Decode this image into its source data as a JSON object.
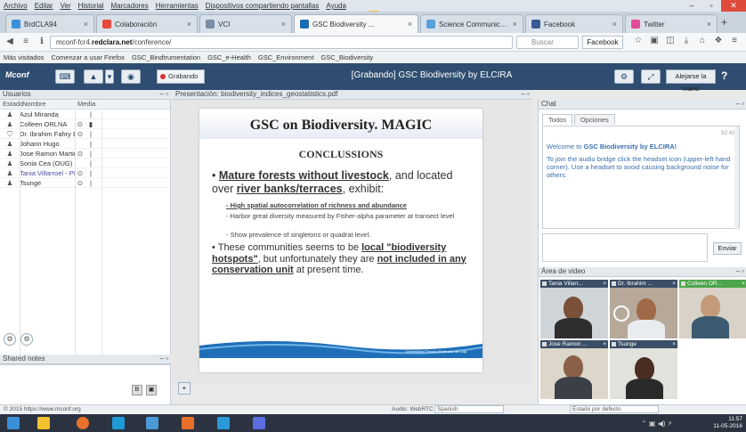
{
  "menu": [
    "Archivo",
    "Editar",
    "Ver",
    "Historial",
    "Marcadores",
    "Herramientas",
    "Dispositivos compartiendo pantallas",
    "Ayuda"
  ],
  "tabs": [
    {
      "label": "BrdCLA94",
      "color": "#3a8fd6"
    },
    {
      "label": "Colaboración",
      "color": "#e64a3a"
    },
    {
      "label": "VCI",
      "color": "#7a8ea3"
    },
    {
      "label": "GSC Biodiversity ...",
      "color": "#1b6bb3"
    },
    {
      "label": "Science Communication",
      "color": "#5aa0d8"
    },
    {
      "label": "Facebook",
      "color": "#3b5998"
    },
    {
      "label": "Twitter",
      "color": "#e64a9a"
    }
  ],
  "nav": {
    "url_prefix": "mconf-fcr4.",
    "url_domain": "redclara.net",
    "url_suffix": "/conference/",
    "search_placeholder": "Buscar",
    "facebook_box": "Facebook"
  },
  "bookmarks": [
    "Más visitados",
    "Comenzar a usar Firefox",
    "GSC_Bindtrumentation",
    "GSC_e-Health",
    "GSC_Environment",
    "GSC_Biodiversity"
  ],
  "app": {
    "logo": "Mconf",
    "record_label": "Grabando",
    "title": "[Grabando] GSC Biodiversity by ELCIRA",
    "hand_label": "Alejarse la mano"
  },
  "users": {
    "panel_title": "Usuarios",
    "columns": [
      "Estado",
      "Nombre",
      "Media"
    ],
    "rows": [
      {
        "status": "♟",
        "name": "Azul Miranda",
        "mic": "",
        "cam": "|"
      },
      {
        "status": "♟",
        "name": "Colleen ORLNA",
        "mic": "⊙",
        "cam": "▮"
      },
      {
        "status": "⛉",
        "name": "Dr. Ibrahim Fahry Bose",
        "mic": "⊙",
        "cam": "|"
      },
      {
        "status": "♟",
        "name": "Johann Hugo",
        "mic": "",
        "cam": "|"
      },
      {
        "status": "♟",
        "name": "Jose Ramon Martinez",
        "mic": "⊙",
        "cam": "|"
      },
      {
        "status": "♟",
        "name": "Sonia Cea (OUG)",
        "mic": "",
        "cam": "|"
      },
      {
        "status": "♟",
        "name": "Tania Villarroel - PI",
        "mic": "⊙",
        "cam": "|"
      },
      {
        "status": "♟",
        "name": "Tsunge",
        "mic": "⊙",
        "cam": "|"
      }
    ]
  },
  "notes": {
    "panel_title": "Shared notes"
  },
  "presentation": {
    "panel_title": "Presentación: biodiversity_indices_geostatistics.pdf",
    "slide_title": "GSC on Biodiversity. MAGIC",
    "slide_subtitle": "CONCLUSSIONS",
    "bullet1_a": "Mature forests without livestock",
    "bullet1_b": ", and located over ",
    "bullet1_c": "river banks/terraces",
    "bullet1_d": ", exhibit:",
    "sub1": "High spatial autocorrelation of richness and abundance",
    "sub2": "Harbor great diversity measured by Fisher-alpha parameter at transect level",
    "sub3": "Show prevalence of singletons or quadrat level.",
    "bullet2_a": "These communities seems to be ",
    "bullet2_b": "local \"biodiversity hotspots\"",
    "bullet2_c": ", but unfortunately they are ",
    "bullet2_d": "not included in any conservation unit",
    "bullet2_e": " at present time.",
    "footer": "Universidad Técnica Particular de Loja"
  },
  "chat": {
    "panel_title": "Chat",
    "tab_all": "Todos",
    "tab_options": "Opciones",
    "time": "02:43",
    "welcome_prefix": "Welcome to ",
    "welcome_bold": "GSC Biodiversity by ELCIRA!",
    "message": "To join the audio bridge click the headset icon (upper-left hand corner). Use a headset to avoid causing background noise for others.",
    "send_label": "Enviar"
  },
  "video": {
    "panel_title": "Área de video",
    "tiles": [
      {
        "name": "Tania Villarr..."
      },
      {
        "name": "Dr. Ibrahim ..."
      },
      {
        "name": "Colleen OR..."
      },
      {
        "name": "Jose Ramon ..."
      },
      {
        "name": "Tsunge"
      }
    ]
  },
  "status": {
    "left": "© 2015 https://www.mconf.org",
    "audio": "Audio: WebRTC",
    "language": "Spanish",
    "device": "Estado por defecto"
  },
  "taskbar": {
    "time": "11:57",
    "date": "11-05-2016"
  }
}
